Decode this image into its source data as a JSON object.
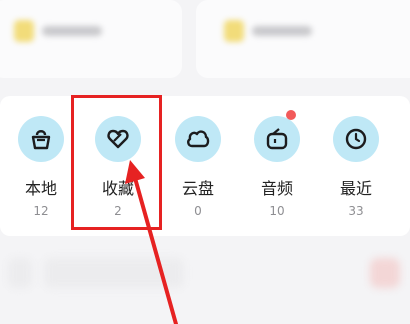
{
  "shortcuts": [
    {
      "label": "本地",
      "count": "12",
      "icon": "bag-icon"
    },
    {
      "label": "收藏",
      "count": "2",
      "icon": "heart-icon"
    },
    {
      "label": "云盘",
      "count": "0",
      "icon": "cloud-icon"
    },
    {
      "label": "音频",
      "count": "10",
      "icon": "radio-icon",
      "badge": true
    },
    {
      "label": "最近",
      "count": "33",
      "icon": "clock-icon"
    }
  ],
  "colors": {
    "icon_circle": "#bfe8f6",
    "icon_stroke": "#1c1c1e",
    "badge": "#f25a5a",
    "annotation": "#e62222"
  }
}
